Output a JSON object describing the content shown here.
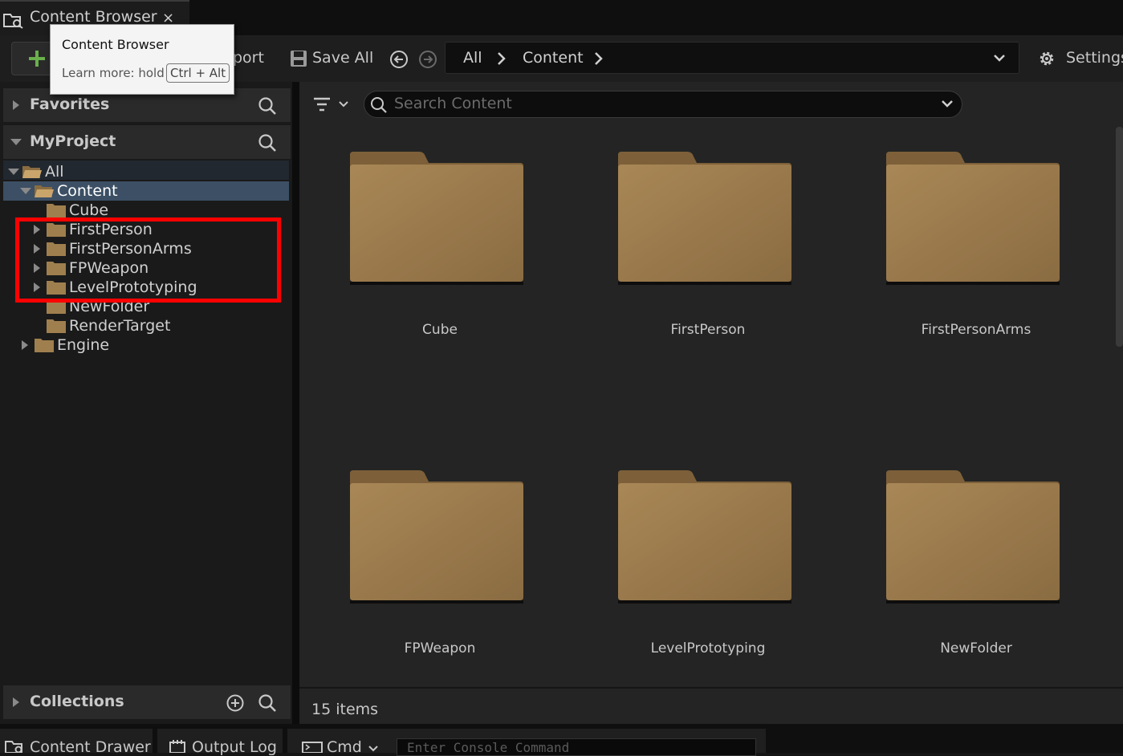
{
  "tab": {
    "title": "Content Browser",
    "close": "×"
  },
  "tooltip": {
    "title": "Content Browser",
    "learn_more": "Learn more: hold",
    "shortcut": "Ctrl + Alt"
  },
  "toolbar": {
    "import_label": "port",
    "save_all_label": "Save All",
    "settings_label": "Settings"
  },
  "breadcrumb": {
    "items": [
      "All",
      "Content"
    ]
  },
  "sidebar": {
    "favorites_label": "Favorites",
    "project_label": "MyProject",
    "collections_label": "Collections",
    "tree": [
      "All",
      "Content",
      "Cube",
      "FirstPerson",
      "FirstPersonArms",
      "FPWeapon",
      "LevelPrototyping",
      "NewFolder",
      "RenderTarget",
      "Engine"
    ]
  },
  "search": {
    "placeholder": "Search Content"
  },
  "assets": [
    "Cube",
    "FirstPerson",
    "FirstPersonArms",
    "FPWeapon",
    "LevelPrototyping",
    "NewFolder"
  ],
  "status": {
    "item_count": "15 items"
  },
  "bottom": {
    "drawer_label": "Content Drawer",
    "output_log_label": "Output Log",
    "cmd_label": "Cmd",
    "console_placeholder": "Enter Console Command"
  },
  "colors": {
    "folder": "#a07f4e",
    "highlight": "#ff0000",
    "selected_row": "#3c4f64",
    "add_icon": "#6ab04c"
  }
}
